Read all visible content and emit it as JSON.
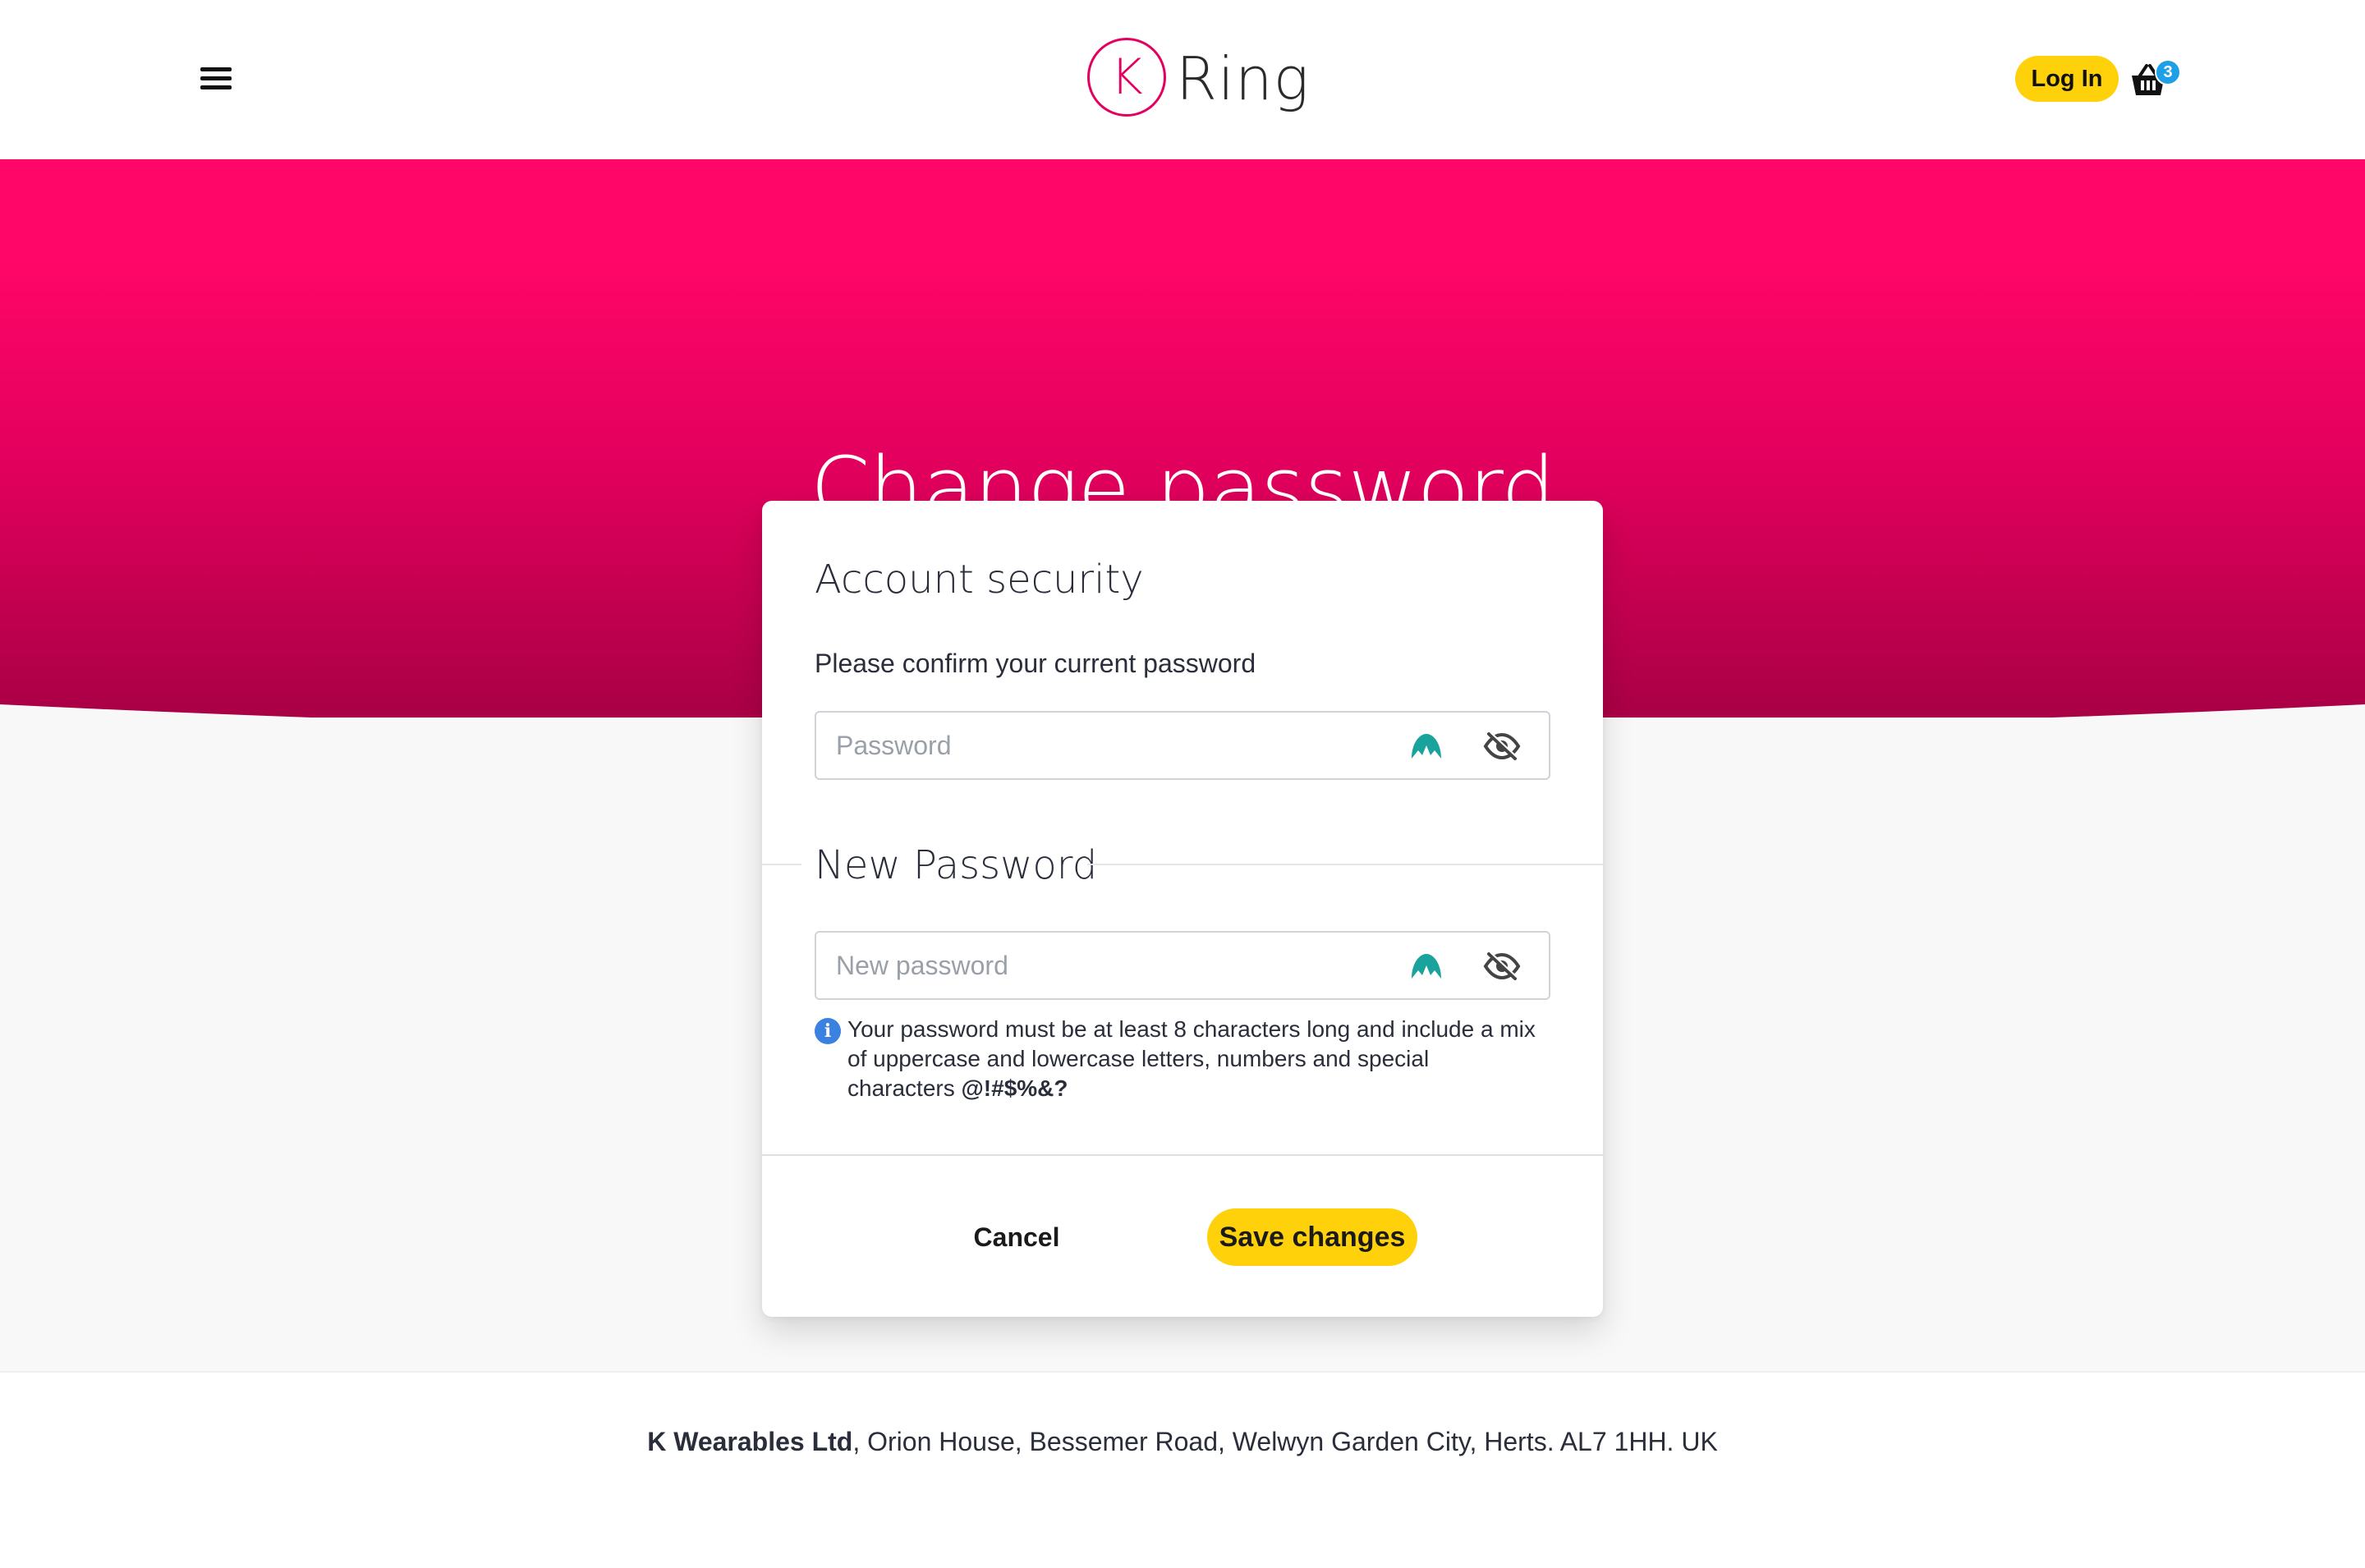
{
  "header": {
    "logo_letter": "K",
    "logo_text": "Ring",
    "login_label": "Log In",
    "basket_count": "3"
  },
  "hero": {
    "title": "Change password"
  },
  "card": {
    "account_security_title": "Account security",
    "current_password_label": "Please confirm your current password",
    "current_password_placeholder": "Password",
    "new_password_title": "New Password",
    "new_password_placeholder": "New password",
    "hint_text": "Your password must be at least 8 characters long and include a mix of uppercase and lowercase letters, numbers and special characters",
    "hint_special_chars": "@!#$%&?",
    "cancel_label": "Cancel",
    "save_label": "Save changes"
  },
  "footer": {
    "company": "K Wearables Ltd",
    "address": ", Orion House, Bessemer Road, Welwyn Garden City, Herts. AL7 1HH. UK"
  },
  "colors": {
    "brand_pink": "#ff0668",
    "accent_yellow": "#ffd10a",
    "badge_blue": "#1ea0e6",
    "info_blue": "#3b82e0",
    "nord_teal": "#1aa39c"
  }
}
